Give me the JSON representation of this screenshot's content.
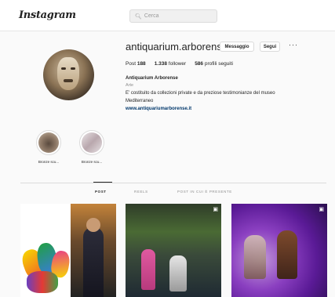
{
  "app": {
    "logo": "Instagram"
  },
  "search": {
    "placeholder": "Cerca",
    "icon": "search-icon"
  },
  "profile": {
    "username": "antiquarium.arborense",
    "buttons": {
      "message": "Messaggio",
      "follow": "Segui",
      "more": "···"
    },
    "stats": [
      {
        "value": "188",
        "label": "Post"
      },
      {
        "value": "1.338",
        "label": "follower"
      },
      {
        "value": "586",
        "label": "profili seguiti"
      }
    ],
    "full_name": "Antiquarium Arborense",
    "category": "Arte",
    "bio": "E' costituito da collezioni private e da preziose testimonianze del museo",
    "bio2": "Mediterraneo",
    "website": "www.antiquariumarborense.it"
  },
  "highlights": [
    {
      "label": "Bronze scu..."
    },
    {
      "label": "Bronze scu..."
    }
  ],
  "tabs": [
    {
      "label": "Post",
      "active": true
    },
    {
      "label": "Reels",
      "active": false
    },
    {
      "label": "Post in cui è presente",
      "active": false
    }
  ],
  "posts": [
    {
      "type": "image"
    },
    {
      "type": "carousel"
    },
    {
      "type": "carousel"
    }
  ]
}
